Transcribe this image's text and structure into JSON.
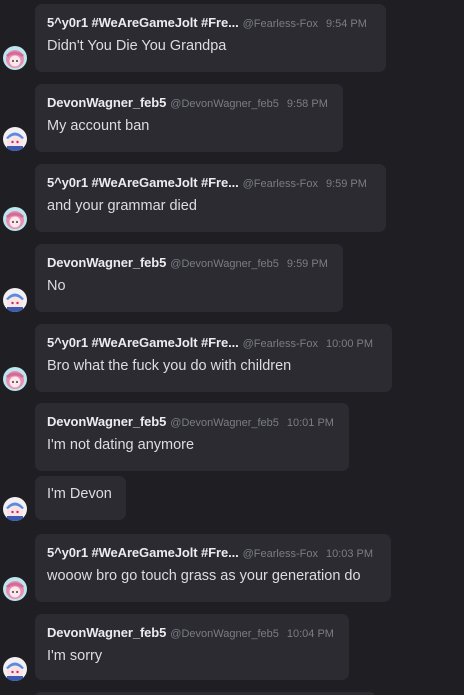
{
  "messages": [
    {
      "name": "5^y0r1 #WeAreGameJolt #Fre...",
      "handle": "@Fearless-Fox",
      "time": "9:54 PM",
      "text": "Didn't You Die You Grandpa",
      "avatar": "pink-hair-anime-avatar"
    },
    {
      "name": "DevonWagner_feb5",
      "handle": "@DevonWagner_feb5",
      "time": "9:58 PM",
      "text": "My account ban",
      "avatar": "blue-hair-anime-avatar"
    },
    {
      "name": "5^y0r1 #WeAreGameJolt #Fre...",
      "handle": "@Fearless-Fox",
      "time": "9:59 PM",
      "text": "and your grammar died",
      "avatar": "pink-hair-anime-avatar"
    },
    {
      "name": "DevonWagner_feb5",
      "handle": "@DevonWagner_feb5",
      "time": "9:59 PM",
      "text": "No",
      "avatar": "blue-hair-anime-avatar"
    },
    {
      "name": "5^y0r1 #WeAreGameJolt #Fre...",
      "handle": "@Fearless-Fox",
      "time": "10:00 PM",
      "text": "Bro what the fuck you do with children",
      "avatar": "pink-hair-anime-avatar"
    },
    {
      "name": "DevonWagner_feb5",
      "handle": "@DevonWagner_feb5",
      "time": "10:01 PM",
      "text": "I'm not dating anymore"
    },
    {
      "text": "I'm Devon",
      "avatar": "blue-hair-anime-avatar"
    },
    {
      "name": "5^y0r1 #WeAreGameJolt #Fre...",
      "handle": "@Fearless-Fox",
      "time": "10:03 PM",
      "text": "wooow bro go touch grass as your generation do",
      "avatar": "pink-hair-anime-avatar"
    },
    {
      "name": "DevonWagner_feb5",
      "handle": "@DevonWagner_feb5",
      "time": "10:04 PM",
      "text": "I'm sorry",
      "avatar": "blue-hair-anime-avatar"
    }
  ],
  "colors": {
    "background": "#1e1e23",
    "bubble": "#2b2b31",
    "name": "#ececf0",
    "meta": "#7c7c86",
    "text": "#dcdce2"
  }
}
